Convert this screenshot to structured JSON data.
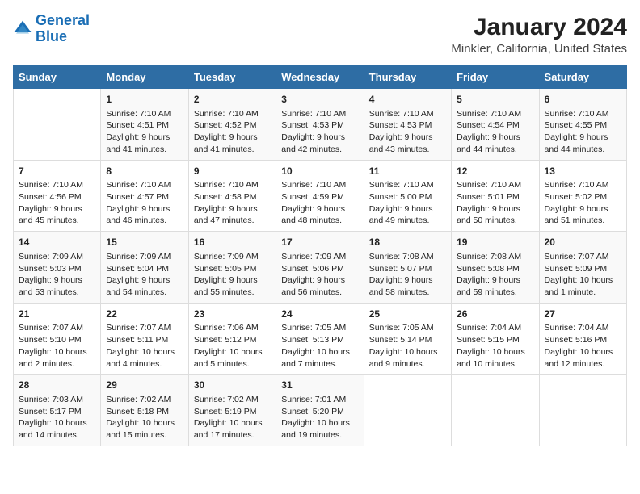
{
  "header": {
    "logo_line1": "General",
    "logo_line2": "Blue",
    "title": "January 2024",
    "subtitle": "Minkler, California, United States"
  },
  "calendar": {
    "days_of_week": [
      "Sunday",
      "Monday",
      "Tuesday",
      "Wednesday",
      "Thursday",
      "Friday",
      "Saturday"
    ],
    "weeks": [
      [
        {
          "day": "",
          "content": ""
        },
        {
          "day": "1",
          "content": "Sunrise: 7:10 AM\nSunset: 4:51 PM\nDaylight: 9 hours\nand 41 minutes."
        },
        {
          "day": "2",
          "content": "Sunrise: 7:10 AM\nSunset: 4:52 PM\nDaylight: 9 hours\nand 41 minutes."
        },
        {
          "day": "3",
          "content": "Sunrise: 7:10 AM\nSunset: 4:53 PM\nDaylight: 9 hours\nand 42 minutes."
        },
        {
          "day": "4",
          "content": "Sunrise: 7:10 AM\nSunset: 4:53 PM\nDaylight: 9 hours\nand 43 minutes."
        },
        {
          "day": "5",
          "content": "Sunrise: 7:10 AM\nSunset: 4:54 PM\nDaylight: 9 hours\nand 44 minutes."
        },
        {
          "day": "6",
          "content": "Sunrise: 7:10 AM\nSunset: 4:55 PM\nDaylight: 9 hours\nand 44 minutes."
        }
      ],
      [
        {
          "day": "7",
          "content": "Sunrise: 7:10 AM\nSunset: 4:56 PM\nDaylight: 9 hours\nand 45 minutes."
        },
        {
          "day": "8",
          "content": "Sunrise: 7:10 AM\nSunset: 4:57 PM\nDaylight: 9 hours\nand 46 minutes."
        },
        {
          "day": "9",
          "content": "Sunrise: 7:10 AM\nSunset: 4:58 PM\nDaylight: 9 hours\nand 47 minutes."
        },
        {
          "day": "10",
          "content": "Sunrise: 7:10 AM\nSunset: 4:59 PM\nDaylight: 9 hours\nand 48 minutes."
        },
        {
          "day": "11",
          "content": "Sunrise: 7:10 AM\nSunset: 5:00 PM\nDaylight: 9 hours\nand 49 minutes."
        },
        {
          "day": "12",
          "content": "Sunrise: 7:10 AM\nSunset: 5:01 PM\nDaylight: 9 hours\nand 50 minutes."
        },
        {
          "day": "13",
          "content": "Sunrise: 7:10 AM\nSunset: 5:02 PM\nDaylight: 9 hours\nand 51 minutes."
        }
      ],
      [
        {
          "day": "14",
          "content": "Sunrise: 7:09 AM\nSunset: 5:03 PM\nDaylight: 9 hours\nand 53 minutes."
        },
        {
          "day": "15",
          "content": "Sunrise: 7:09 AM\nSunset: 5:04 PM\nDaylight: 9 hours\nand 54 minutes."
        },
        {
          "day": "16",
          "content": "Sunrise: 7:09 AM\nSunset: 5:05 PM\nDaylight: 9 hours\nand 55 minutes."
        },
        {
          "day": "17",
          "content": "Sunrise: 7:09 AM\nSunset: 5:06 PM\nDaylight: 9 hours\nand 56 minutes."
        },
        {
          "day": "18",
          "content": "Sunrise: 7:08 AM\nSunset: 5:07 PM\nDaylight: 9 hours\nand 58 minutes."
        },
        {
          "day": "19",
          "content": "Sunrise: 7:08 AM\nSunset: 5:08 PM\nDaylight: 9 hours\nand 59 minutes."
        },
        {
          "day": "20",
          "content": "Sunrise: 7:07 AM\nSunset: 5:09 PM\nDaylight: 10 hours\nand 1 minute."
        }
      ],
      [
        {
          "day": "21",
          "content": "Sunrise: 7:07 AM\nSunset: 5:10 PM\nDaylight: 10 hours\nand 2 minutes."
        },
        {
          "day": "22",
          "content": "Sunrise: 7:07 AM\nSunset: 5:11 PM\nDaylight: 10 hours\nand 4 minutes."
        },
        {
          "day": "23",
          "content": "Sunrise: 7:06 AM\nSunset: 5:12 PM\nDaylight: 10 hours\nand 5 minutes."
        },
        {
          "day": "24",
          "content": "Sunrise: 7:05 AM\nSunset: 5:13 PM\nDaylight: 10 hours\nand 7 minutes."
        },
        {
          "day": "25",
          "content": "Sunrise: 7:05 AM\nSunset: 5:14 PM\nDaylight: 10 hours\nand 9 minutes."
        },
        {
          "day": "26",
          "content": "Sunrise: 7:04 AM\nSunset: 5:15 PM\nDaylight: 10 hours\nand 10 minutes."
        },
        {
          "day": "27",
          "content": "Sunrise: 7:04 AM\nSunset: 5:16 PM\nDaylight: 10 hours\nand 12 minutes."
        }
      ],
      [
        {
          "day": "28",
          "content": "Sunrise: 7:03 AM\nSunset: 5:17 PM\nDaylight: 10 hours\nand 14 minutes."
        },
        {
          "day": "29",
          "content": "Sunrise: 7:02 AM\nSunset: 5:18 PM\nDaylight: 10 hours\nand 15 minutes."
        },
        {
          "day": "30",
          "content": "Sunrise: 7:02 AM\nSunset: 5:19 PM\nDaylight: 10 hours\nand 17 minutes."
        },
        {
          "day": "31",
          "content": "Sunrise: 7:01 AM\nSunset: 5:20 PM\nDaylight: 10 hours\nand 19 minutes."
        },
        {
          "day": "",
          "content": ""
        },
        {
          "day": "",
          "content": ""
        },
        {
          "day": "",
          "content": ""
        }
      ]
    ]
  }
}
